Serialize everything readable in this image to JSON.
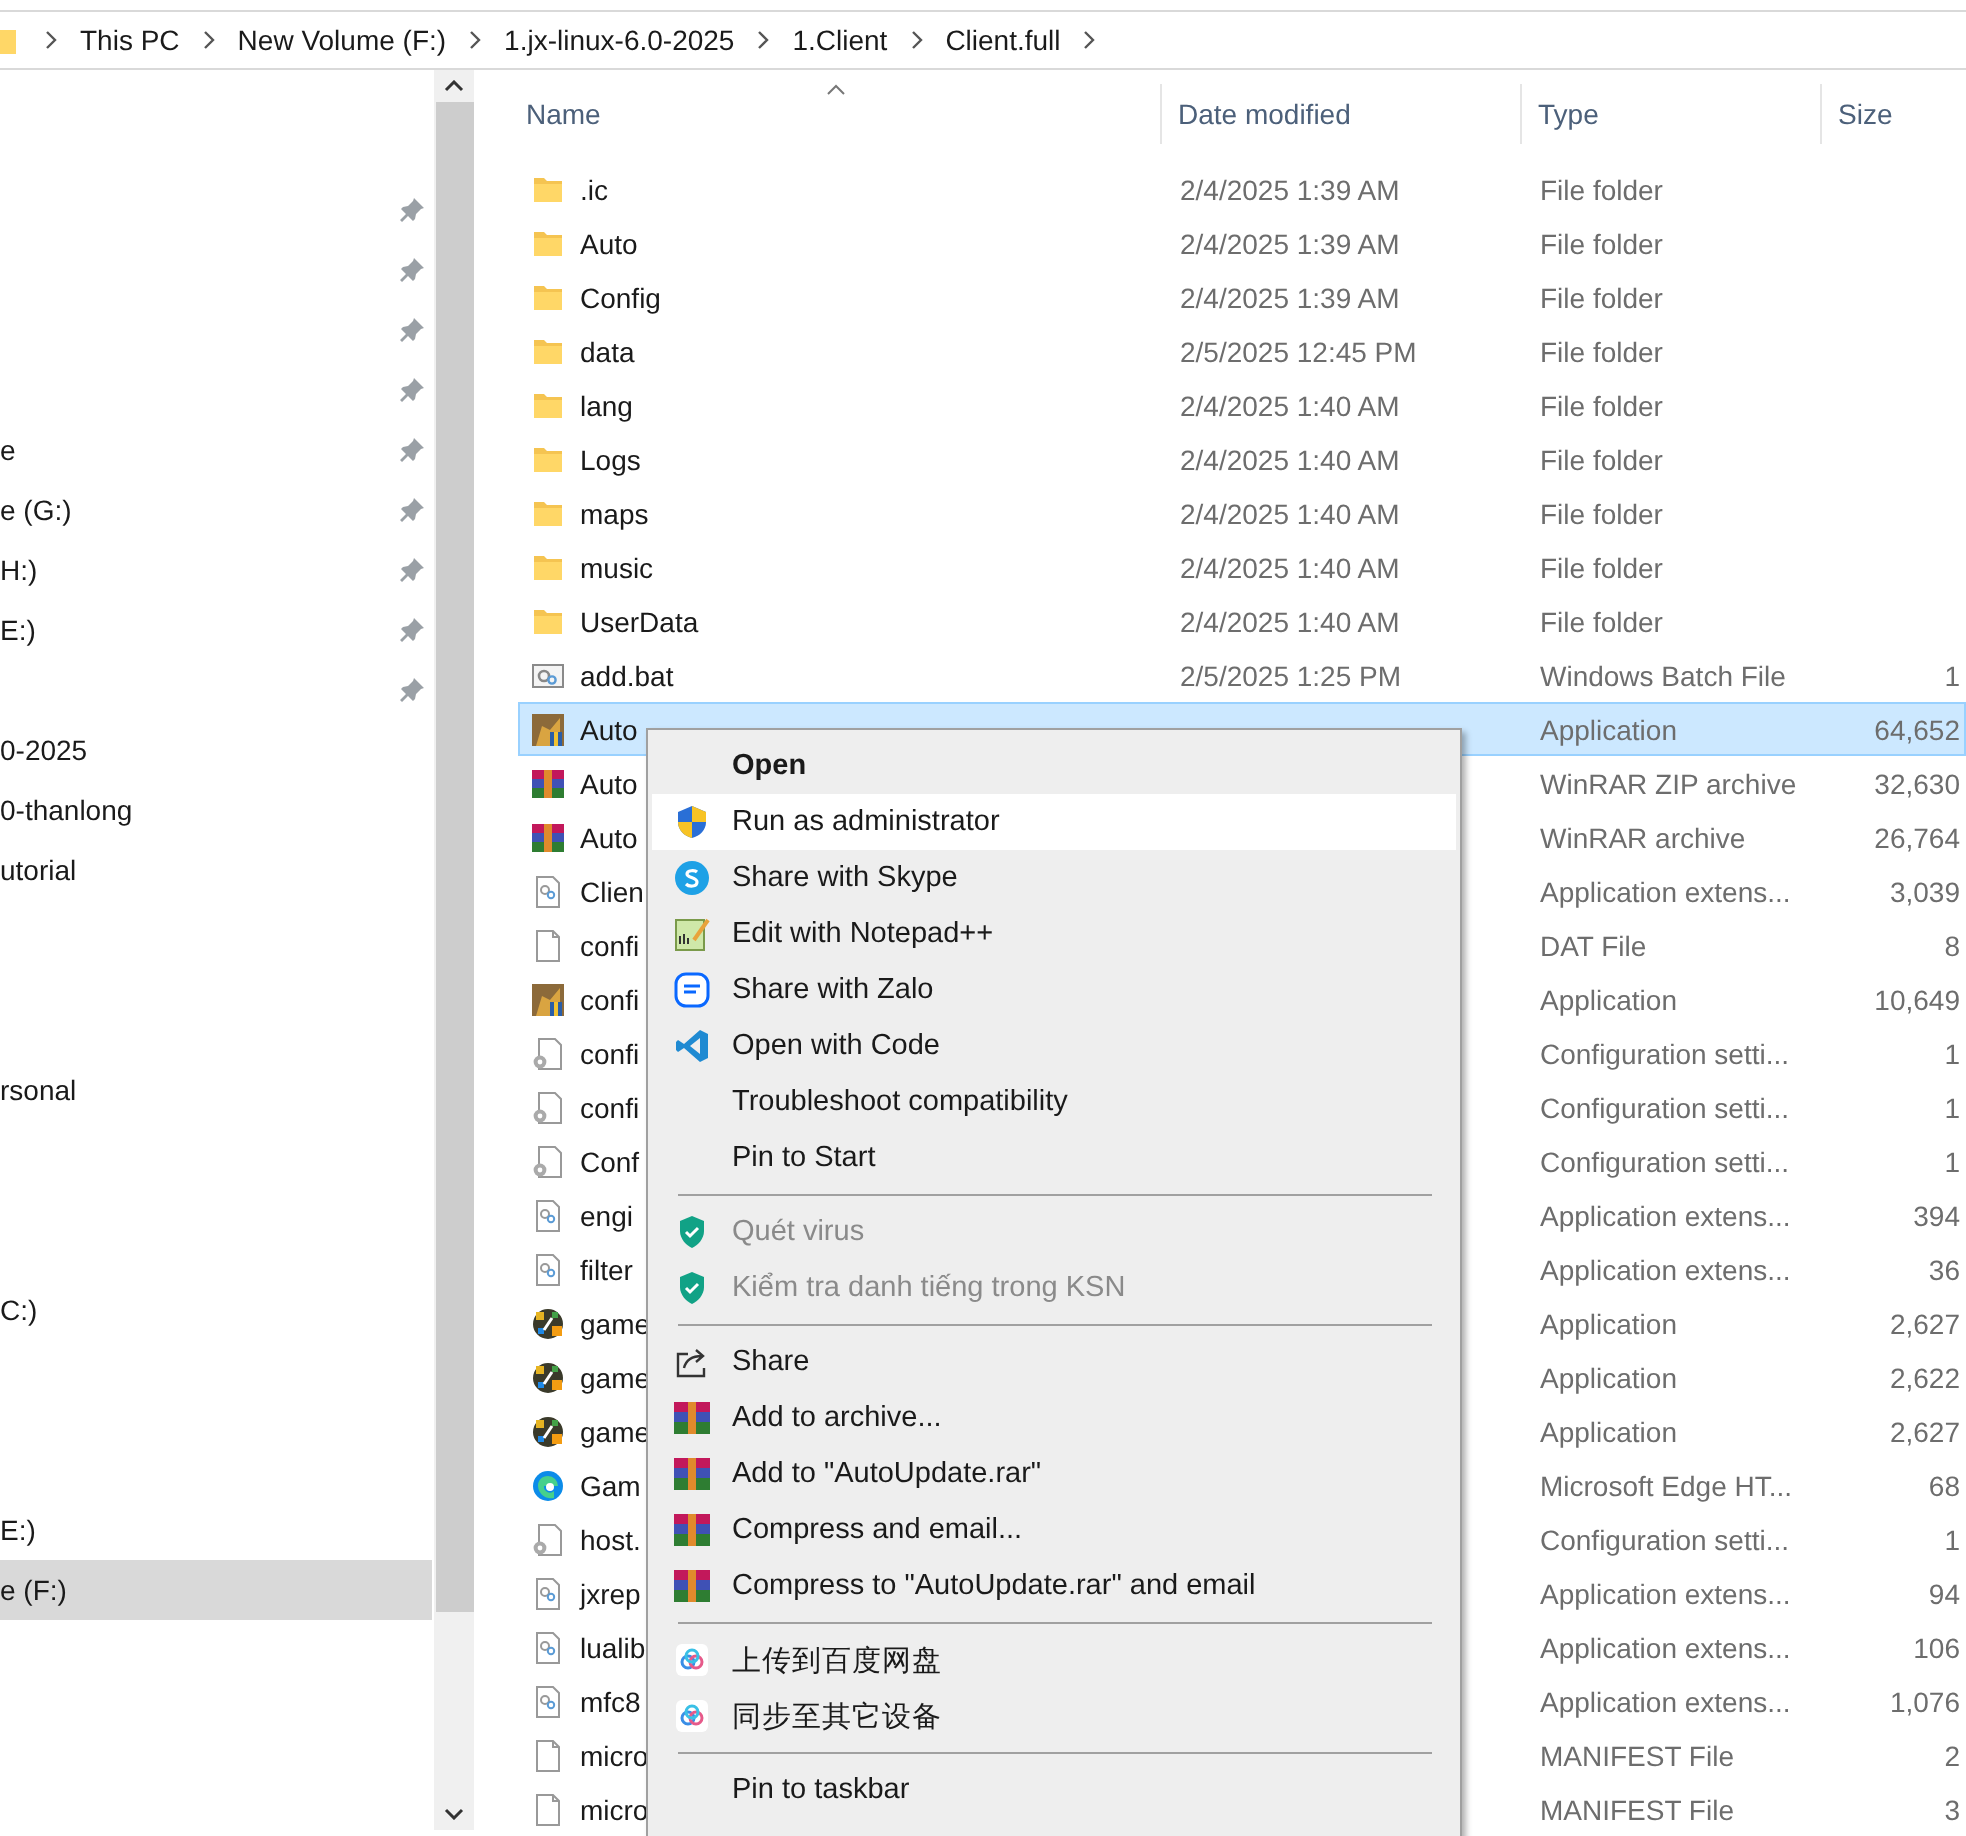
{
  "breadcrumb": [
    "This PC",
    "New Volume (F:)",
    "1.jx-linux-6.0-2025",
    "1.Client",
    "Client.full"
  ],
  "sidebar": {
    "sections": [
      {
        "items": [
          {
            "pinned": true,
            "selected": false
          },
          {
            "pinned": true,
            "selected": false
          },
          {
            "pinned": true,
            "selected": false
          },
          {
            "pinned": true,
            "selected": false
          },
          {
            "label": "e",
            "pinned": true,
            "selected": false
          },
          {
            "label": "e (G:)",
            "pinned": true,
            "selected": false
          },
          {
            "label": "H:)",
            "pinned": true,
            "selected": false
          },
          {
            "label": "E:)",
            "pinned": true,
            "selected": false
          },
          {
            "pinned": true,
            "selected": false
          },
          {
            "label": "0-2025",
            "pinned": false,
            "selected": false
          },
          {
            "label": "0-thanlong",
            "pinned": false,
            "selected": false
          },
          {
            "label": "utorial",
            "pinned": false,
            "selected": false
          }
        ]
      },
      {
        "items": [
          {
            "label": "rsonal",
            "pinned": false,
            "selected": false
          }
        ]
      },
      {
        "items": [
          {
            "label": "C:)",
            "pinned": false,
            "selected": false
          }
        ]
      },
      {
        "items": [
          {
            "label": "E:)",
            "pinned": false,
            "selected": false
          },
          {
            "label": "e (F:)",
            "pinned": false,
            "selected": true
          }
        ]
      }
    ]
  },
  "table": {
    "columns": [
      "Name",
      "Date modified",
      "Type",
      "Size"
    ],
    "rows": [
      {
        "kind": "folder",
        "name": ".ic",
        "date": "2/4/2025 1:39 AM",
        "type": "File folder",
        "selected": false
      },
      {
        "kind": "folder",
        "name": "Auto",
        "date": "2/4/2025 1:39 AM",
        "type": "File folder",
        "selected": false
      },
      {
        "kind": "folder",
        "name": "Config",
        "date": "2/4/2025 1:39 AM",
        "type": "File folder",
        "selected": false
      },
      {
        "kind": "folder",
        "name": "data",
        "date": "2/5/2025 12:45 PM",
        "type": "File folder",
        "selected": false
      },
      {
        "kind": "folder",
        "name": "lang",
        "date": "2/4/2025 1:40 AM",
        "type": "File folder",
        "selected": false
      },
      {
        "kind": "folder",
        "name": "Logs",
        "date": "2/4/2025 1:40 AM",
        "type": "File folder",
        "selected": false
      },
      {
        "kind": "folder",
        "name": "maps",
        "date": "2/4/2025 1:40 AM",
        "type": "File folder",
        "selected": false
      },
      {
        "kind": "folder",
        "name": "music",
        "date": "2/4/2025 1:40 AM",
        "type": "File folder",
        "selected": false
      },
      {
        "kind": "folder",
        "name": "UserData",
        "date": "2/4/2025 1:40 AM",
        "type": "File folder",
        "selected": false
      },
      {
        "kind": "batch",
        "name": "add.bat",
        "date": "2/5/2025 1:25 PM",
        "type": "Windows Batch File",
        "size": "1",
        "selected": false
      },
      {
        "kind": "app",
        "name": "Auto",
        "type": "Application",
        "size": "64,652",
        "selected": true
      },
      {
        "kind": "winrar",
        "name": "Auto",
        "type": "WinRAR ZIP archive",
        "size": "32,630",
        "selected": false
      },
      {
        "kind": "winrar",
        "name": "Auto",
        "type": "WinRAR archive",
        "size": "26,764",
        "selected": false
      },
      {
        "kind": "dll",
        "name": "Clien",
        "type": "Application extens...",
        "size": "3,039",
        "selected": false
      },
      {
        "kind": "file",
        "name": "confi",
        "type": "DAT File",
        "size": "8",
        "selected": false
      },
      {
        "kind": "app",
        "name": "confi",
        "type": "Application",
        "size": "10,649",
        "selected": false
      },
      {
        "kind": "config",
        "name": "confi",
        "type": "Configuration setti...",
        "size": "1",
        "selected": false
      },
      {
        "kind": "config",
        "name": "confi",
        "type": "Configuration setti...",
        "size": "1",
        "selected": false
      },
      {
        "kind": "config",
        "name": "Conf",
        "type": "Configuration setti...",
        "size": "1",
        "selected": false
      },
      {
        "kind": "dll",
        "name": "engi",
        "type": "Application extens...",
        "size": "394",
        "selected": false
      },
      {
        "kind": "dll",
        "name": "filter",
        "type": "Application extens...",
        "size": "36",
        "selected": false
      },
      {
        "kind": "game",
        "name": "game",
        "type": "Application",
        "size": "2,627",
        "selected": false
      },
      {
        "kind": "game",
        "name": "game",
        "type": "Application",
        "size": "2,622",
        "selected": false
      },
      {
        "kind": "game",
        "name": "game",
        "type": "Application",
        "size": "2,627",
        "selected": false
      },
      {
        "kind": "edge",
        "name": "Gam",
        "type": "Microsoft Edge HT...",
        "size": "68",
        "selected": false
      },
      {
        "kind": "config",
        "name": "host.",
        "type": "Configuration setti...",
        "size": "1",
        "selected": false
      },
      {
        "kind": "dll",
        "name": "jxrep",
        "type": "Application extens...",
        "size": "94",
        "selected": false
      },
      {
        "kind": "dll",
        "name": "lualib",
        "type": "Application extens...",
        "size": "106",
        "selected": false
      },
      {
        "kind": "dll",
        "name": "mfc8",
        "type": "Application extens...",
        "size": "1,076",
        "selected": false
      },
      {
        "kind": "file",
        "name": "micro",
        "type": "MANIFEST File",
        "size": "2",
        "selected": false
      },
      {
        "kind": "file",
        "name": "micro",
        "type": "MANIFEST File",
        "size": "3",
        "selected": false
      }
    ]
  },
  "context_menu": {
    "items": [
      {
        "kind": "plain",
        "label": "Open",
        "default": true,
        "selected": false,
        "disabled": false
      },
      {
        "kind": "uac",
        "label": "Run as administrator",
        "default": false,
        "selected": true,
        "disabled": false
      },
      {
        "kind": "skype",
        "label": "Share with Skype",
        "default": false,
        "selected": false,
        "disabled": false
      },
      {
        "kind": "notepad",
        "label": "Edit with Notepad++",
        "default": false,
        "selected": false,
        "disabled": false
      },
      {
        "kind": "zalo",
        "label": "Share with Zalo",
        "default": false,
        "selected": false,
        "disabled": false
      },
      {
        "kind": "vscode",
        "label": "Open with Code",
        "default": false,
        "selected": false,
        "disabled": false
      },
      {
        "kind": "plain",
        "label": "Troubleshoot compatibility",
        "default": false,
        "selected": false,
        "disabled": false
      },
      {
        "kind": "plain",
        "label": "Pin to Start",
        "default": false,
        "selected": false,
        "disabled": false
      },
      {
        "kind": "separator"
      },
      {
        "kind": "kaspersky",
        "label": "Quét virus",
        "default": false,
        "selected": false,
        "disabled": true
      },
      {
        "kind": "kaspersky",
        "label": "Kiểm tra danh tiếng trong KSN",
        "default": false,
        "selected": false,
        "disabled": true
      },
      {
        "kind": "separator"
      },
      {
        "kind": "share",
        "label": "Share",
        "default": false,
        "selected": false,
        "disabled": false
      },
      {
        "kind": "winrar",
        "label": "Add to archive...",
        "default": false,
        "selected": false,
        "disabled": false
      },
      {
        "kind": "winrar",
        "label": "Add to \"AutoUpdate.rar\"",
        "default": false,
        "selected": false,
        "disabled": false
      },
      {
        "kind": "winrar",
        "label": "Compress and email...",
        "default": false,
        "selected": false,
        "disabled": false
      },
      {
        "kind": "winrar",
        "label": "Compress to \"AutoUpdate.rar\" and email",
        "default": false,
        "selected": false,
        "disabled": false
      },
      {
        "kind": "separator"
      },
      {
        "kind": "baidu",
        "label": "上传到百度网盘",
        "default": false,
        "selected": false,
        "disabled": false
      },
      {
        "kind": "baidu",
        "label": "同步至其它设备",
        "default": false,
        "selected": false,
        "disabled": false
      },
      {
        "kind": "separator"
      },
      {
        "kind": "plain",
        "label": "Pin to taskbar",
        "default": false,
        "selected": false,
        "disabled": false
      }
    ]
  }
}
